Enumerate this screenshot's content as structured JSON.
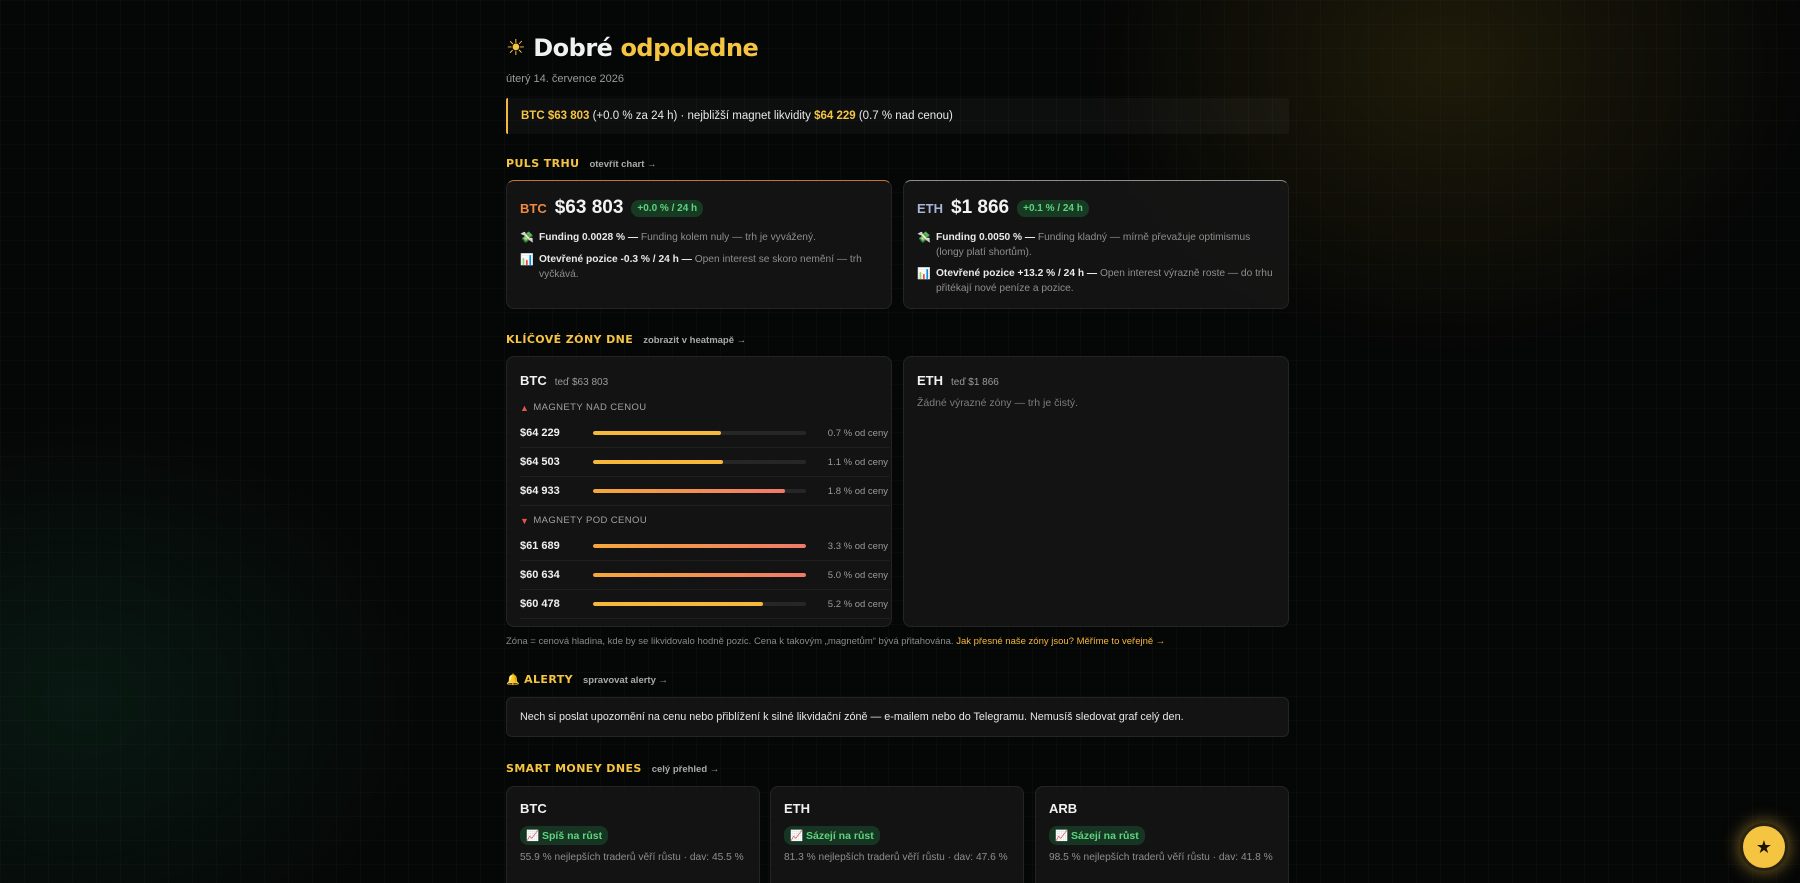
{
  "header": {
    "greeting_prefix": "Dobré",
    "greeting_accent": "odpoledne",
    "date": "úterý 14. července 2026"
  },
  "banner": {
    "btc_label": "BTC $63 803",
    "change_text": " (+0.0 % za 24 h) · nejbližší magnet likvidity ",
    "magnet_price": "$64 229",
    "magnet_note": " (0.7 % nad cenou)"
  },
  "pulse": {
    "title": "PULS TRHU",
    "link": "otevřít chart →",
    "btc": {
      "symbol": "BTC",
      "price": "$63 803",
      "change": "+0.0 % / 24 h",
      "funding_bold": "Funding 0.0028 % —",
      "funding_text": "Funding kolem nuly — trh je vyvážený.",
      "oi_bold": "Otevřené pozice -0.3 % / 24 h —",
      "oi_text": "Open interest se skoro nemění — trh vyčkává."
    },
    "eth": {
      "symbol": "ETH",
      "price": "$1 866",
      "change": "+0.1 % / 24 h",
      "funding_bold": "Funding 0.0050 % —",
      "funding_text": "Funding kladný — mírně převažuje optimismus (longy platí shortům).",
      "oi_bold": "Otevřené pozice +13.2 % / 24 h —",
      "oi_text": "Open interest výrazně roste — do trhu přitékají nové peníze a pozice."
    }
  },
  "zones": {
    "title": "KLÍČOVÉ ZÓNY DNE",
    "link": "zobrazit v heatmapě →",
    "btc": {
      "symbol": "BTC",
      "now": "teď $63 803",
      "above_label": "MAGNETY NAD CENOU",
      "below_label": "MAGNETY POD CENOU",
      "above": [
        {
          "price": "$64 229",
          "pct": "0.7 % od ceny",
          "strength": 0.6
        },
        {
          "price": "$64 503",
          "pct": "1.1 % od ceny",
          "strength": 0.61
        },
        {
          "price": "$64 933",
          "pct": "1.8 % od ceny",
          "strength": 0.9
        }
      ],
      "below": [
        {
          "price": "$61 689",
          "pct": "3.3 % od ceny",
          "strength": 1.0
        },
        {
          "price": "$60 634",
          "pct": "5.0 % od ceny",
          "strength": 1.0
        },
        {
          "price": "$60 478",
          "pct": "5.2 % od ceny",
          "strength": 0.8
        }
      ]
    },
    "eth": {
      "symbol": "ETH",
      "now": "teď $1 866",
      "empty": "Žádné výrazné zóny — trh je čistý."
    },
    "note": "Zóna = cenová hladina, kde by se likvidovalo hodně pozic. Cena k takovým „magnetům“ bývá přitahována.",
    "note_link": "Jak přesné naše zóny jsou? Měříme to veřejně →"
  },
  "alerts": {
    "title": "ALERTY",
    "link": "spravovat alerty →",
    "text": "Nech si poslat upozornění na cenu nebo přiblížení k silné likvidační zóně — e-mailem nebo do Telegramu. Nemusíš sledovat graf celý den."
  },
  "smart_money": {
    "title": "SMART MONEY DNES",
    "link": "celý přehled →",
    "items": [
      {
        "symbol": "BTC",
        "tag": "Spíš na růst",
        "text": "55.9 % nejlepších traderů věří růstu · dav: 45.5 %"
      },
      {
        "symbol": "ETH",
        "tag": "Sázejí na růst",
        "text": "81.3 % nejlepších traderů věří růstu · dav: 47.6 %"
      },
      {
        "symbol": "ARB",
        "tag": "Sázejí na růst",
        "text": "98.5 % nejlepších traderů věří růstu · dav: 41.8 %"
      }
    ]
  },
  "colors": {
    "accent": "#f5c542",
    "btc": "#f08a3e",
    "eth": "#a9b4d6",
    "positive": "#5fd37e"
  },
  "icons": {
    "greeting": "sun-icon",
    "funding": "money-icon",
    "open_interest": "chart-icon",
    "above": "up-triangle-icon",
    "below": "down-triangle-icon",
    "alerts": "bell-icon",
    "trend": "chart-up-icon",
    "fab": "star-icon"
  }
}
